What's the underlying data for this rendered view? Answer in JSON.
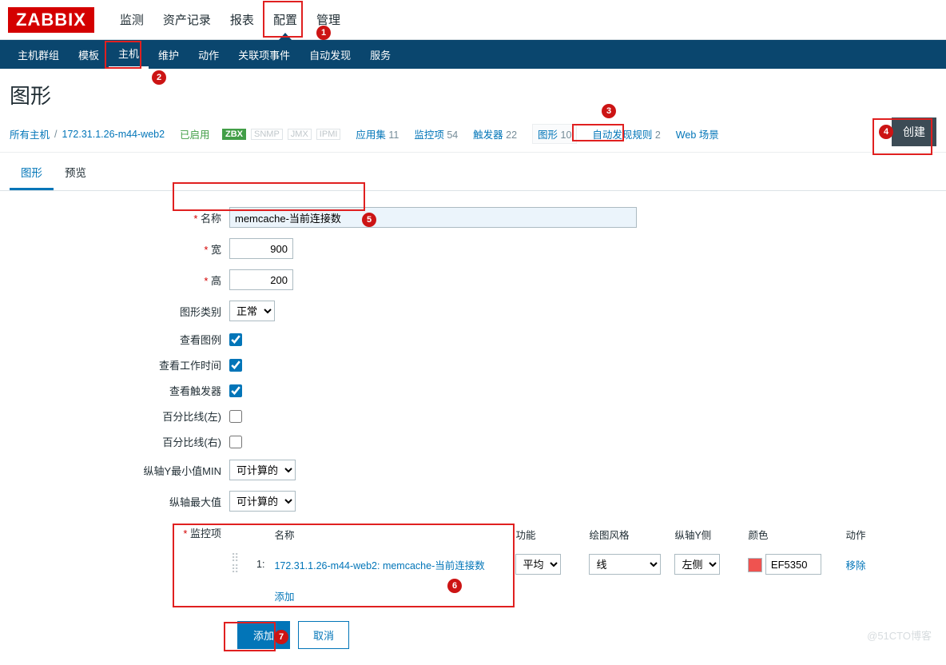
{
  "logo": "ZABBIX",
  "topNav": {
    "items": [
      "监测",
      "资产记录",
      "报表",
      "配置",
      "管理"
    ],
    "activeIndex": 3
  },
  "subNav": {
    "items": [
      "主机群组",
      "模板",
      "主机",
      "维护",
      "动作",
      "关联项事件",
      "自动发现",
      "服务"
    ],
    "activeIndex": 2
  },
  "pageTitle": "图形",
  "breadcrumb": {
    "allHosts": "所有主机",
    "host": "172.31.1.26-m44-web2",
    "status": "已启用",
    "zbx": "ZBX",
    "snmp": "SNMP",
    "jmx": "JMX",
    "ipmi": "IPMI",
    "links": [
      {
        "label": "应用集",
        "count": "11"
      },
      {
        "label": "监控项",
        "count": "54"
      },
      {
        "label": "触发器",
        "count": "22"
      },
      {
        "label": "图形",
        "count": "10",
        "boxed": true
      },
      {
        "label": "自动发现规则",
        "count": "2"
      },
      {
        "label": "Web 场景",
        "count": ""
      }
    ]
  },
  "createBtn": "创建",
  "tabs": {
    "items": [
      "图形",
      "预览"
    ],
    "activeIndex": 0
  },
  "form": {
    "labels": {
      "name": "名称",
      "width": "宽",
      "height": "高",
      "type": "图形类别",
      "legend": "查看图例",
      "worktime": "查看工作时间",
      "triggers": "查看触发器",
      "plLeft": "百分比线(左)",
      "plRight": "百分比线(右)",
      "ymin": "纵轴Y最小值MIN",
      "ymax": "纵轴最大值",
      "items": "监控项"
    },
    "values": {
      "name": "memcache-当前连接数",
      "width": "900",
      "height": "200",
      "type": "正常",
      "legend": true,
      "worktime": true,
      "triggers": true,
      "plLeft": false,
      "plRight": false,
      "ymin": "可计算的",
      "ymax": "可计算的"
    },
    "itemsTable": {
      "headers": {
        "name": "名称",
        "func": "功能",
        "draw": "绘图风格",
        "yaxis": "纵轴Y侧",
        "color": "颜色",
        "action": "动作"
      },
      "row": {
        "idx": "1:",
        "name": "172.31.1.26-m44-web2: memcache-当前连接数",
        "func": "平均",
        "draw": "线",
        "yaxis": "左侧",
        "colorHex": "EF5350",
        "colorSwatch": "#ef5350",
        "remove": "移除"
      },
      "addLink": "添加"
    },
    "actions": {
      "submit": "添加",
      "cancel": "取消"
    }
  },
  "watermark": "@51CTO博客"
}
